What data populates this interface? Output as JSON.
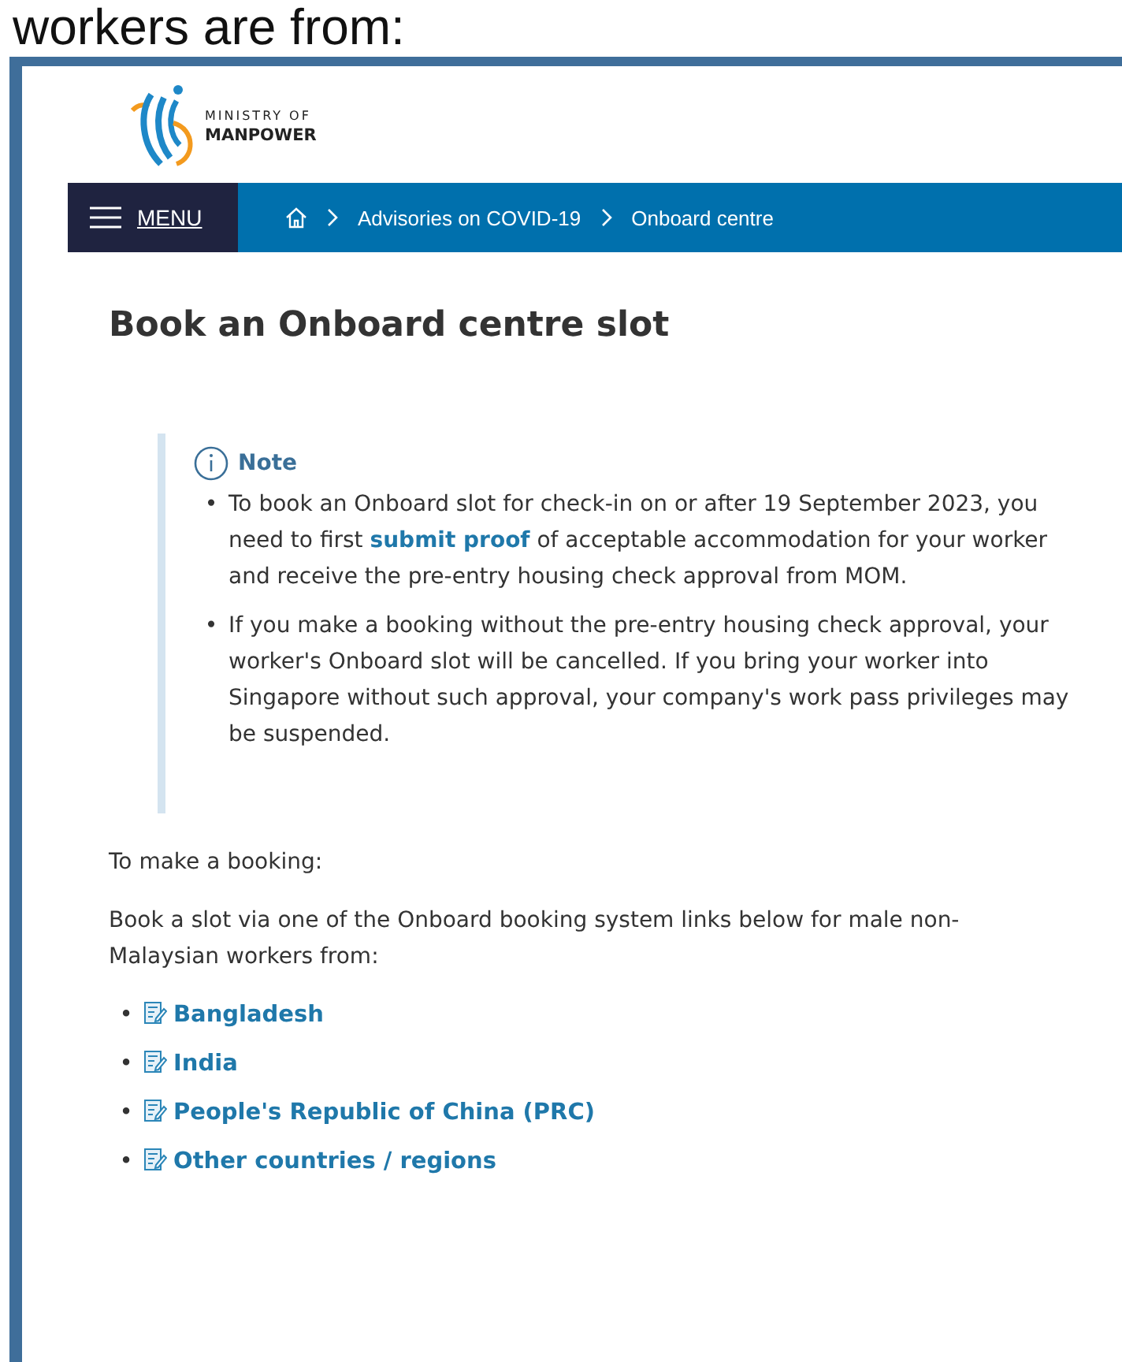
{
  "caption": "workers are from:",
  "logo": {
    "line_1": "MINISTRY OF",
    "line_2": "MANPOWER"
  },
  "nav": {
    "menu_label": "MENU",
    "breadcrumbs": [
      {
        "label": "Advisories on COVID-19"
      },
      {
        "label": "Onboard centre"
      }
    ]
  },
  "title": "Book an Onboard centre slot",
  "note": {
    "heading": "Note",
    "bullet": "•",
    "items": [
      "To book an Onboard slot for check-in on or after 19 September 2023, you need to first **submit proof** of acceptable accommodation for your worker and receive the pre-entry housing check approval from MOM.",
      "If you make a booking without the pre-entry housing check approval, your worker's Onboard slot will be cancelled. If you bring your worker into Singapore without such approval, your company's work pass privileges may be suspended."
    ]
  },
  "paragraphs": [
    "To make a booking:",
    "Book a slot via one of the Onboard booking system links below for male non-Malaysian workers from:"
  ],
  "links_bullet": "•",
  "links": [
    {
      "label": "Bangladesh"
    },
    {
      "label": "India"
    },
    {
      "label": "People's Republic of China (PRC)"
    },
    {
      "label": "Other countries / regions"
    }
  ]
}
